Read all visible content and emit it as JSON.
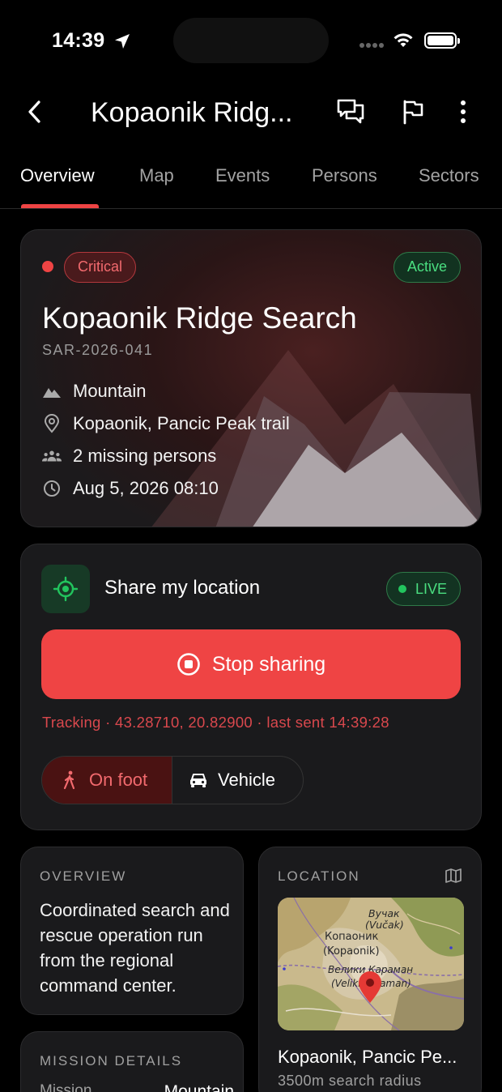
{
  "status_bar": {
    "time": "14:39"
  },
  "app_bar": {
    "title": "Kopaonik Ridg..."
  },
  "tabs": [
    {
      "label": "Overview",
      "active": true
    },
    {
      "label": "Map",
      "active": false
    },
    {
      "label": "Events",
      "active": false
    },
    {
      "label": "Persons",
      "active": false
    },
    {
      "label": "Sectors",
      "active": false
    }
  ],
  "hero": {
    "priority": "Critical",
    "state": "Active",
    "title": "Kopaonik Ridge Search",
    "id": "SAR-2026-041",
    "meta": [
      {
        "icon": "mountain-icon",
        "text": "Mountain"
      },
      {
        "icon": "pin-icon",
        "text": "Kopaonik, Pancic Peak trail"
      },
      {
        "icon": "people-icon",
        "text": "2 missing persons"
      },
      {
        "icon": "clock-icon",
        "text": "Aug 5, 2026 08:10"
      }
    ]
  },
  "share": {
    "label": "Share my location",
    "live": "LIVE",
    "stop_label": "Stop sharing",
    "tracking": "Tracking · 43.28710, 20.82900 · last sent 14:39:28",
    "modes": [
      {
        "label": "On foot",
        "selected": true
      },
      {
        "label": "Vehicle",
        "selected": false
      }
    ]
  },
  "overview": {
    "heading": "OVERVIEW",
    "text": "Coordinated search and rescue operation run from the regional command center."
  },
  "location": {
    "heading": "LOCATION",
    "name": "Kopaonik, Pancic Pe...",
    "radius": "3500m search radius",
    "map_labels": [
      "Вучак",
      "(Vučak)",
      "Копаоник",
      "(Kopaonik)",
      "Велики Караман",
      "(Veliki Karaman)"
    ]
  },
  "mission": {
    "heading": "MISSION DETAILS",
    "row_key": "Mission",
    "row_value": "Mountain"
  },
  "colors": {
    "accent": "#ef4444",
    "live_green": "#4ade80",
    "background": "#000000",
    "card": "#1a1a1c"
  }
}
